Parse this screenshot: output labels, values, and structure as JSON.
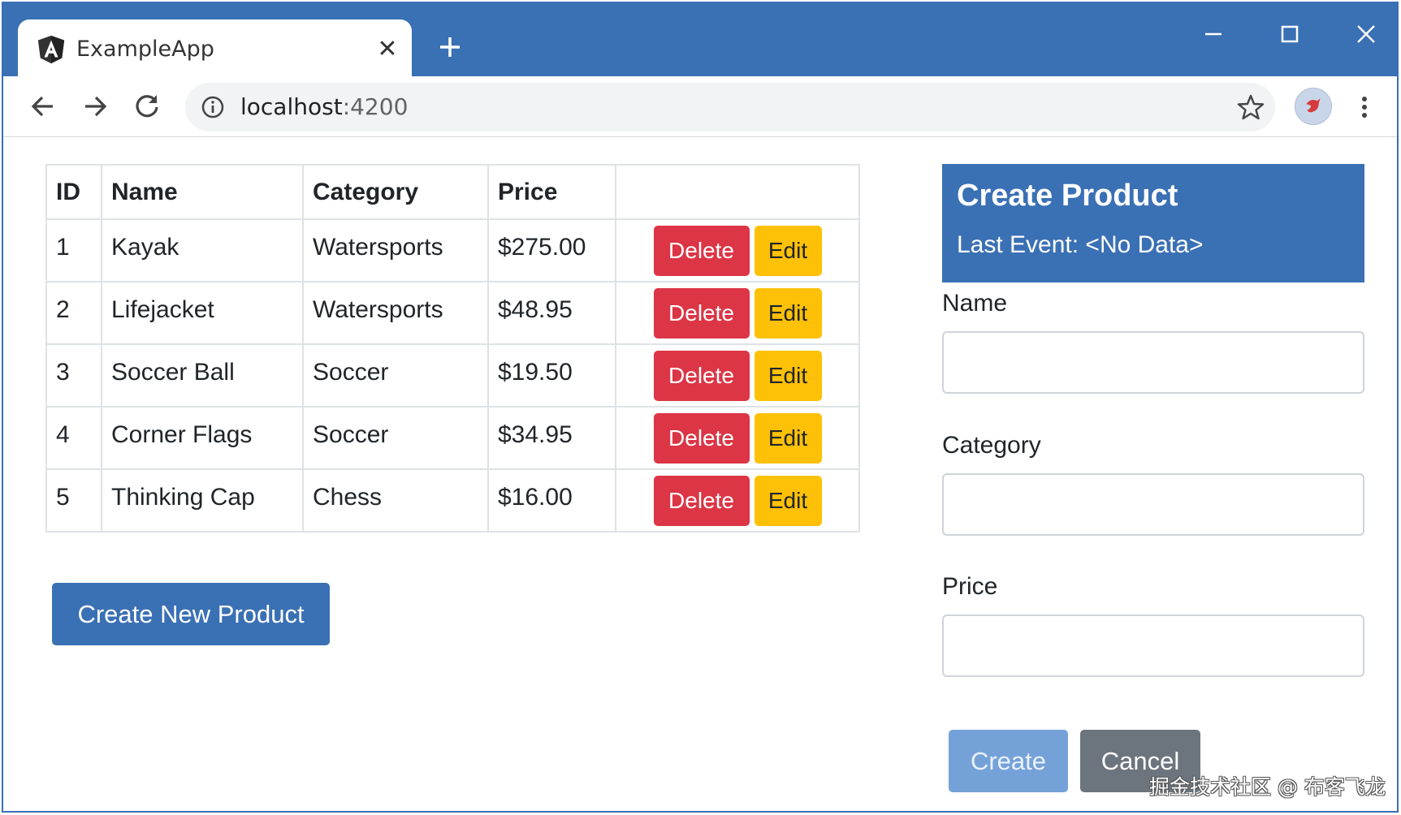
{
  "browser": {
    "tab": {
      "title": "ExampleApp",
      "close_glyph": "✕",
      "icon": "angular-icon"
    },
    "new_tab_icon": "plus-icon",
    "window_controls": [
      "minimize-icon",
      "maximize-icon",
      "close-icon"
    ],
    "nav_icons": [
      "back-arrow-icon",
      "forward-arrow-icon",
      "reload-icon"
    ],
    "address": {
      "host": "localhost",
      "port": ":4200",
      "info_icon": "info-icon",
      "bookmark_icon": "star-icon"
    },
    "profile_icon": "profile-avatar-icon",
    "menu_icon": "kebab-menu-icon"
  },
  "table": {
    "headers": [
      "ID",
      "Name",
      "Category",
      "Price",
      ""
    ],
    "rows": [
      {
        "id": "1",
        "name": "Kayak",
        "category": "Watersports",
        "price": "$275.00"
      },
      {
        "id": "2",
        "name": "Lifejacket",
        "category": "Watersports",
        "price": "$48.95"
      },
      {
        "id": "3",
        "name": "Soccer Ball",
        "category": "Soccer",
        "price": "$19.50"
      },
      {
        "id": "4",
        "name": "Corner Flags",
        "category": "Soccer",
        "price": "$34.95"
      },
      {
        "id": "5",
        "name": "Thinking Cap",
        "category": "Chess",
        "price": "$16.00"
      }
    ],
    "delete_label": "Delete",
    "edit_label": "Edit"
  },
  "create_new_label": "Create New Product",
  "form": {
    "title": "Create Product",
    "last_event": "Last Event: <No Data>",
    "name_label": "Name",
    "name_value": "",
    "category_label": "Category",
    "category_value": "",
    "price_label": "Price",
    "price_value": "",
    "create_label": "Create",
    "cancel_label": "Cancel"
  },
  "colors": {
    "primary": "#3a70b4",
    "danger": "#dc3545",
    "warning": "#ffc107",
    "secondary": "#6c757d",
    "primary_disabled": "#74a2d8"
  },
  "watermark": "掘金技术社区 @ 布客飞龙"
}
